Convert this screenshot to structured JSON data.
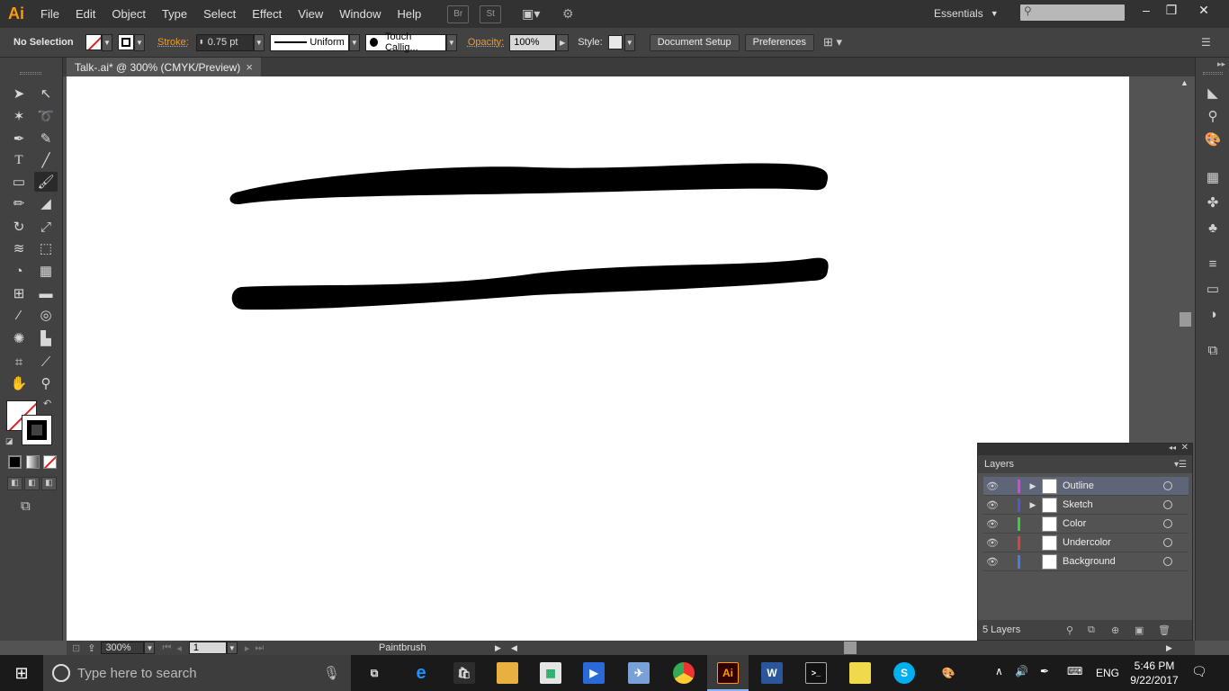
{
  "app": {
    "logo": "Ai"
  },
  "menu": [
    "File",
    "Edit",
    "Object",
    "Type",
    "Select",
    "Effect",
    "View",
    "Window",
    "Help"
  ],
  "menubar_icons": {
    "bridge": "Br",
    "stock": "St"
  },
  "workspace": {
    "label": "Essentials"
  },
  "control": {
    "selection": "No Selection",
    "stroke_label": "Stroke:",
    "stroke_value": "0.75 pt",
    "profile": "Uniform",
    "brush": "Touch Callig...",
    "opacity_label": "Opacity:",
    "opacity_value": "100%",
    "style_label": "Style:",
    "doc_setup": "Document Setup",
    "preferences": "Preferences"
  },
  "document": {
    "tab_title": "Talk-.ai* @ 300% (CMYK/Preview)",
    "close": "×"
  },
  "status": {
    "zoom": "300%",
    "artboard": "1",
    "tool": "Paintbrush"
  },
  "layers": {
    "tab": "Layers",
    "count": "5 Layers",
    "items": [
      {
        "name": "Outline",
        "color": "#e040e0",
        "selected": true,
        "expandable": true
      },
      {
        "name": "Sketch",
        "color": "#4a5ad8",
        "selected": false,
        "expandable": true
      },
      {
        "name": "Color",
        "color": "#3ccc3c",
        "selected": false,
        "expandable": false
      },
      {
        "name": "Undercolor",
        "color": "#e04040",
        "selected": false,
        "expandable": false
      },
      {
        "name": "Background",
        "color": "#4a7ae8",
        "selected": false,
        "expandable": false
      }
    ]
  },
  "taskbar": {
    "search_placeholder": "Type here to search",
    "language": "ENG",
    "time": "5:46 PM",
    "date": "9/22/2017"
  },
  "colors": {
    "accent": "#ff9a00",
    "stroke_label": "#f29a2e",
    "selected_layer": "#5f6579"
  }
}
